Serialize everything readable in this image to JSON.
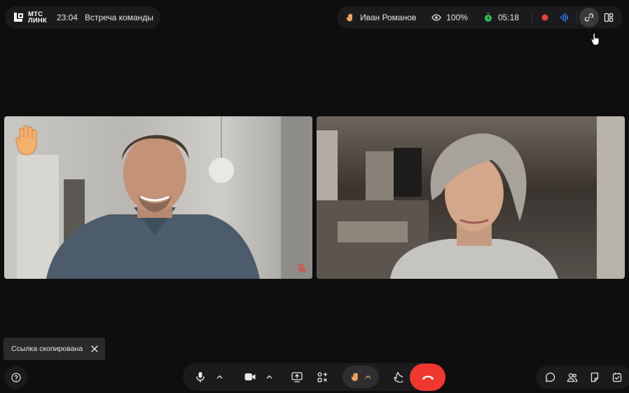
{
  "app": {
    "logo_line1": "МТС",
    "logo_line2": "ЛИНК"
  },
  "meeting": {
    "time": "23:04",
    "title": "Встреча команды"
  },
  "status_bar": {
    "user_name": "Иван Романов",
    "zoom": "100%",
    "duration": "05:18"
  },
  "toast": {
    "text": "Ссылка скопирована"
  },
  "colors": {
    "background": "#0e0e0f",
    "panel": "#1b1b1d",
    "end_call": "#f0372e",
    "record": "#e8433a",
    "timer": "#2dbf5a",
    "audio": "#2f7ff0",
    "hand": "#f0a05a"
  },
  "icons": {
    "top_bar": [
      "hand-icon",
      "eye-icon",
      "timer-icon",
      "record-icon",
      "audio-wave-icon",
      "link-icon",
      "layout-icon"
    ],
    "controls": [
      "microphone-icon",
      "chevron-up-icon",
      "camera-icon",
      "chevron-up-icon",
      "share-screen-icon",
      "apps-icon",
      "hand-icon",
      "chevron-up-icon",
      "reaction-icon",
      "more-icon",
      "end-call-icon"
    ],
    "bottom_right": [
      "chat-icon",
      "participants-icon",
      "notes-icon",
      "tasks-icon"
    ],
    "other": [
      "help-icon",
      "close-icon",
      "mic-muted-icon",
      "raised-hand-emoji"
    ]
  },
  "participants": [
    {
      "raised_hand": true,
      "mic_muted": true
    },
    {
      "raised_hand": false,
      "mic_muted": false
    }
  ]
}
